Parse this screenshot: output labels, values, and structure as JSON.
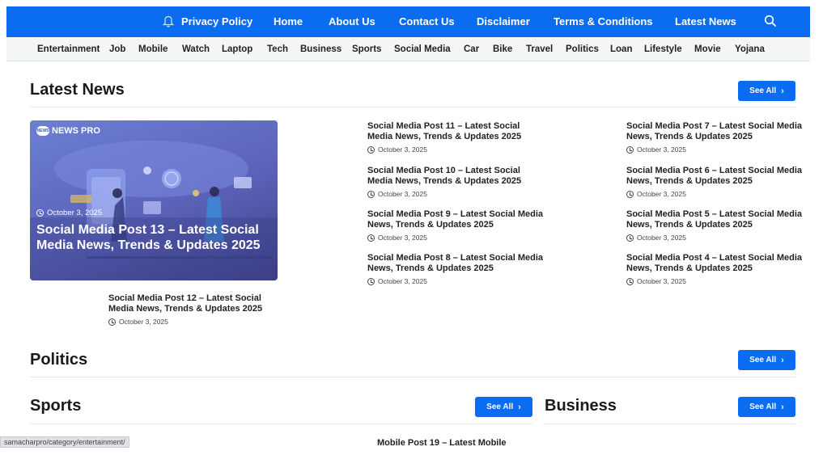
{
  "topnav": {
    "items": [
      "Privacy Policy",
      "Home",
      "About Us",
      "Contact Us",
      "Disclaimer",
      "Terms & Conditions",
      "Latest News"
    ]
  },
  "categories": [
    "Entertainment",
    "Job",
    "Mobile",
    "Watch",
    "Laptop",
    "Tech",
    "Business",
    "Sports",
    "Social Media",
    "Car",
    "Bike",
    "Travel",
    "Politics",
    "Loan",
    "Lifestyle",
    "Movie",
    "Yojana"
  ],
  "latest": {
    "title": "Latest News",
    "see_all": "See All",
    "featured": {
      "brand": "NEWS PRO",
      "date": "October 3, 2025",
      "title": "Social Media Post 13 – Latest Social Media News, Trends & Updates 2025"
    },
    "posts_mid": [
      {
        "title": "Social Media Post 11 – Latest Social Media News, Trends & Updates 2025",
        "date": "October 3, 2025"
      },
      {
        "title": "Social Media Post 10 – Latest Social Media News, Trends & Updates 2025",
        "date": "October 3, 2025"
      },
      {
        "title": "Social Media Post 9 – Latest Social Media News, Trends & Updates 2025",
        "date": "October 3, 2025"
      },
      {
        "title": "Social Media Post 8 – Latest Social Media News, Trends & Updates 2025",
        "date": "October 3, 2025"
      }
    ],
    "posts_right": [
      {
        "title": "Social Media Post 7 – Latest Social Media News, Trends & Updates 2025",
        "date": "October 3, 2025"
      },
      {
        "title": "Social Media Post 6 – Latest Social Media News, Trends & Updates 2025",
        "date": "October 3, 2025"
      },
      {
        "title": "Social Media Post 5 – Latest Social Media News, Trends & Updates 2025",
        "date": "October 3, 2025"
      },
      {
        "title": "Social Media Post 4 – Latest Social Media News, Trends & Updates 2025",
        "date": "October 3, 2025"
      }
    ],
    "post_below": {
      "title": "Social Media Post 12 – Latest Social Media News, Trends & Updates 2025",
      "date": "October 3, 2025"
    }
  },
  "politics": {
    "title": "Politics",
    "see_all": "See All"
  },
  "sports": {
    "title": "Sports",
    "see_all": "See All"
  },
  "business": {
    "title": "Business",
    "see_all": "See All"
  },
  "sports_post": {
    "title": "Mobile Post 19 – Latest Mobile"
  },
  "status_url": "samacharpro/category/entertainment/",
  "colors": {
    "accent": "#0a6cf0"
  }
}
